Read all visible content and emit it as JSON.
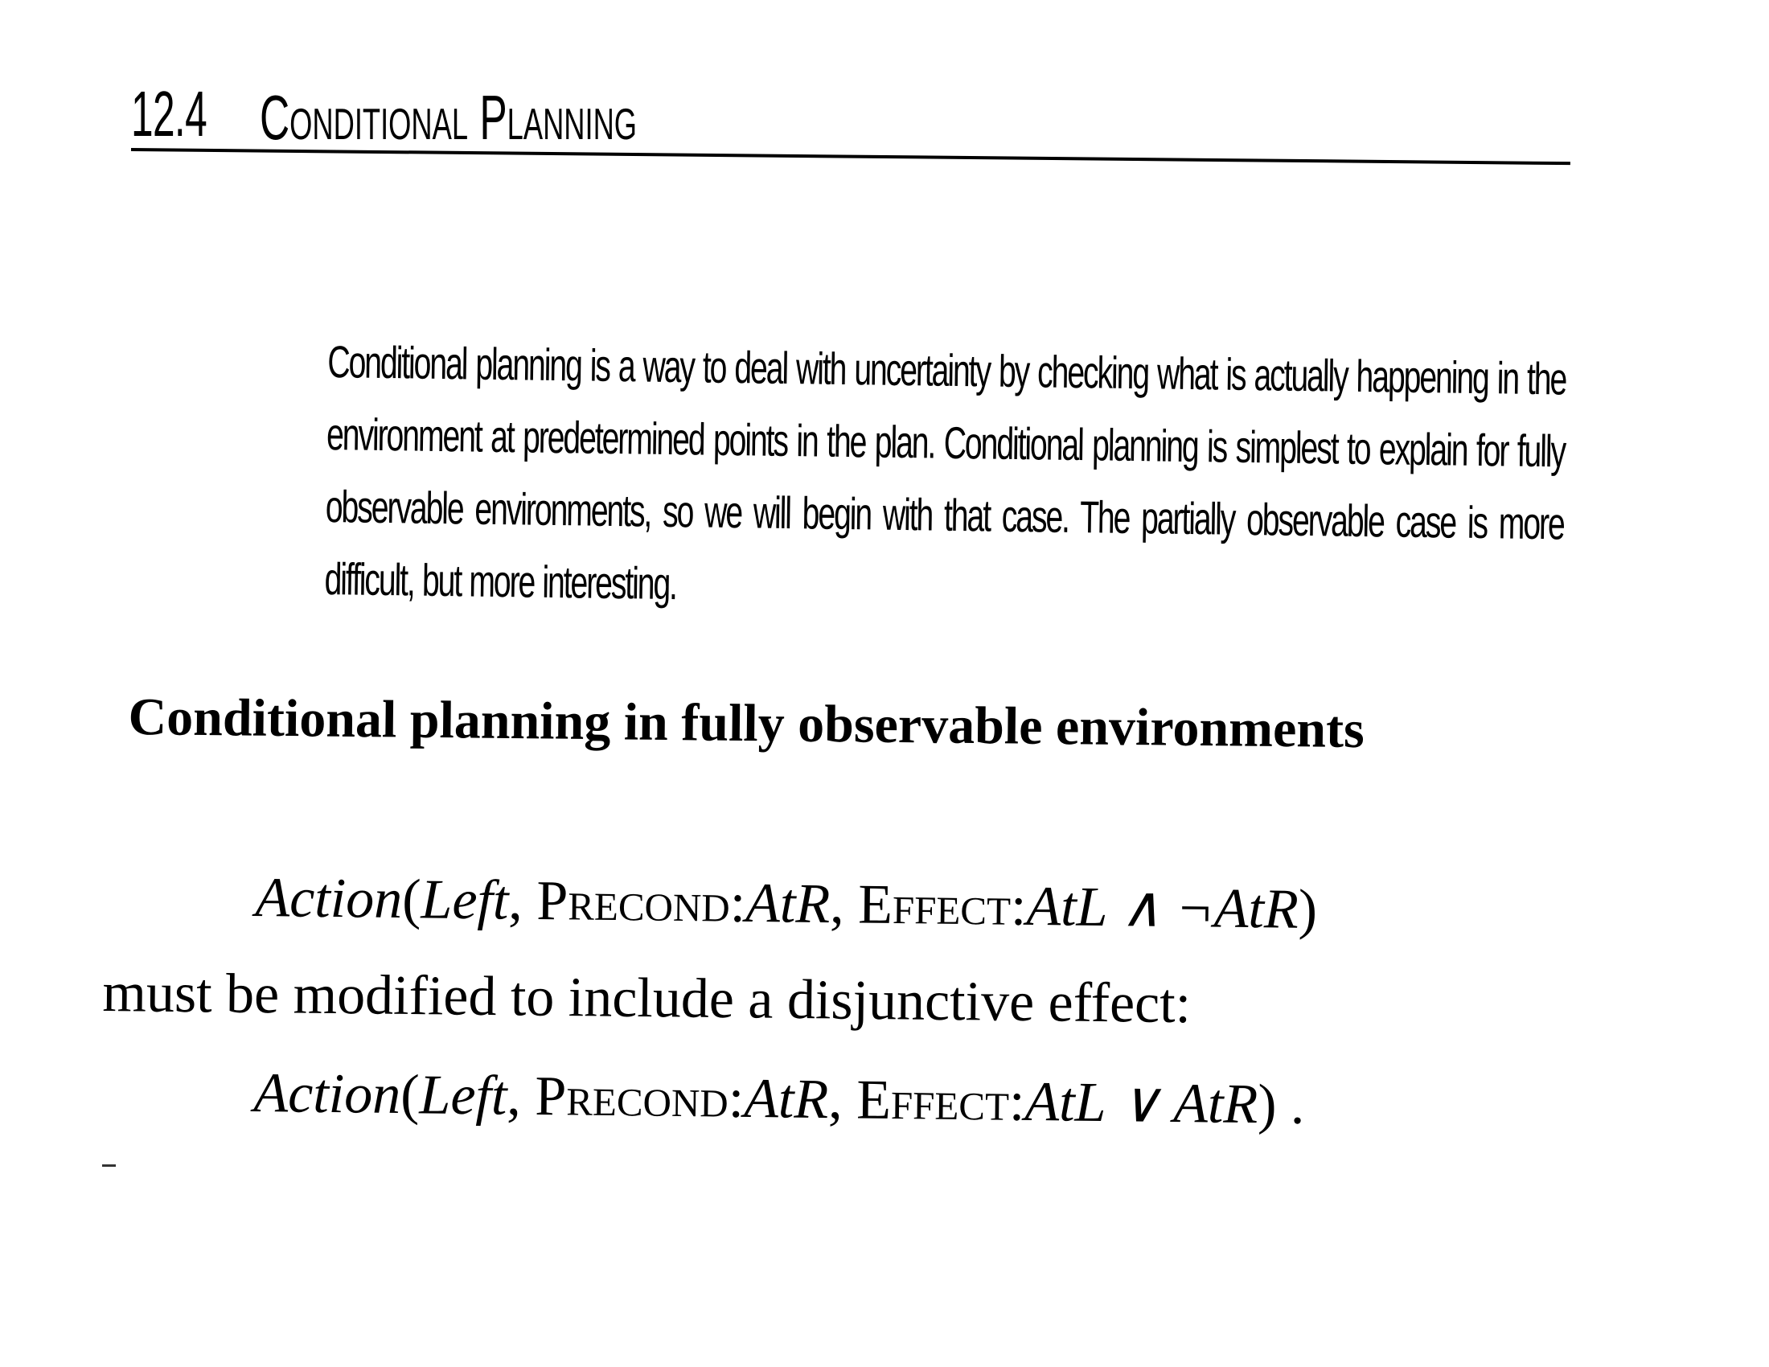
{
  "section": {
    "number": "12.4",
    "title": "Conditional Planning"
  },
  "intro": {
    "text": "Conditional planning is a way to deal with uncertainty by checking what is actually happening in the environment at predetermined points in the plan. Conditional planning is simplest to explain for fully observable environments, so we will begin with that case. The partially observable case is more difficult, but more interesting."
  },
  "subsection": {
    "title": "Conditional planning in fully observable environments"
  },
  "formula_1": {
    "action": "Action",
    "open_paren": "(",
    "left": "Left",
    "comma1": ", ",
    "precond_label": "Precond",
    "colon1": ":",
    "precond_value": "AtR",
    "comma2": ", ",
    "effect_label": "Effect",
    "colon2": ":",
    "effect_value": "AtL ∧ ¬AtR",
    "close": ")"
  },
  "body": {
    "text": "must be modified to include a disjunctive effect:"
  },
  "formula_2": {
    "action": "Action",
    "open_paren": "(",
    "left": "Left",
    "comma1": ", ",
    "precond_label": "Precond",
    "colon1": ":",
    "precond_value": "AtR",
    "comma2": ", ",
    "effect_label": "Effect",
    "colon2": ":",
    "effect_value": "AtL ∨ AtR",
    "close": ") ."
  }
}
